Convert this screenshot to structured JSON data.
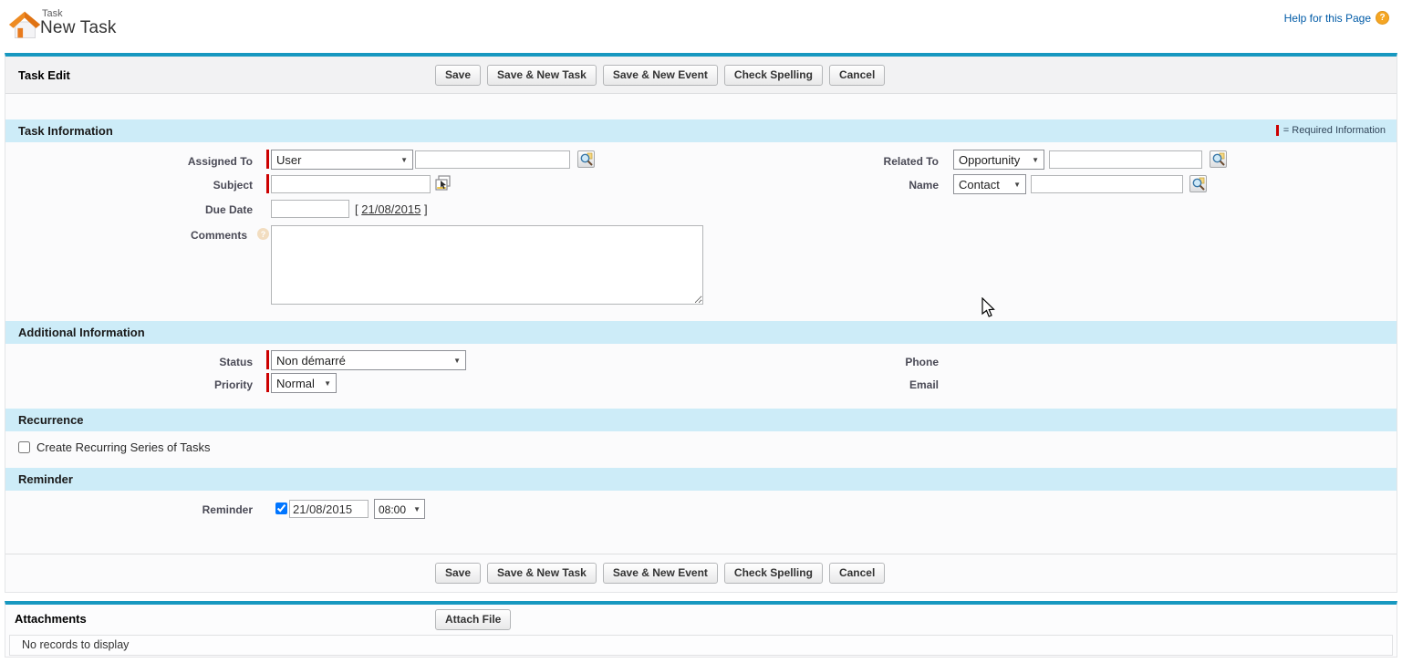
{
  "page": {
    "entity_label": "Task",
    "title": "New Task",
    "help_link": "Help for this Page"
  },
  "icons": {
    "dropdown_arrow": "▼",
    "help_question": "?",
    "comments_help": "?",
    "app_icon": "task-home-icon",
    "lookup": "magnifier-icon",
    "subject_combo": "combobox-picker-icon"
  },
  "task_edit": {
    "title": "Task Edit",
    "buttons": [
      "Save",
      "Save & New Task",
      "Save & New Event",
      "Check Spelling",
      "Cancel"
    ]
  },
  "sections": {
    "task_information": {
      "title": "Task Information",
      "required_legend": "= Required Information",
      "fields": {
        "assigned_to": {
          "label": "Assigned To",
          "required": true,
          "type_value": "User",
          "text_value": ""
        },
        "related_to": {
          "label": "Related To",
          "type_value": "Opportunity",
          "text_value": ""
        },
        "subject": {
          "label": "Subject",
          "required": true,
          "value": ""
        },
        "name": {
          "label": "Name",
          "type_value": "Contact",
          "text_value": ""
        },
        "due_date": {
          "label": "Due Date",
          "value": "",
          "bracket_left": "[",
          "today_link": "21/08/2015",
          "bracket_right": "]"
        },
        "comments": {
          "label": "Comments",
          "value": ""
        }
      }
    },
    "additional_information": {
      "title": "Additional Information",
      "fields": {
        "status": {
          "label": "Status",
          "required": true,
          "value": "Non démarré"
        },
        "priority": {
          "label": "Priority",
          "required": true,
          "value": "Normal"
        },
        "phone": {
          "label": "Phone",
          "value": ""
        },
        "email": {
          "label": "Email",
          "value": ""
        }
      }
    },
    "recurrence": {
      "title": "Recurrence",
      "checkbox_label": "Create Recurring Series of Tasks",
      "checked": false
    },
    "reminder": {
      "title": "Reminder",
      "label": "Reminder",
      "checked": true,
      "date_value": "21/08/2015",
      "time_value": "08:00"
    }
  },
  "bottom_buttons": [
    "Save",
    "Save & New Task",
    "Save & New Event",
    "Check Spelling",
    "Cancel"
  ],
  "attachments": {
    "title": "Attachments",
    "attach_button": "Attach File",
    "empty_text": "No records to display"
  },
  "colors": {
    "teal_bar": "#1798c0",
    "section_header_bg": "#cdecf8",
    "required_red": "#cc0000",
    "link_blue": "#015ba7",
    "help_icon_orange": "#f5a623",
    "label_gray": "#4a4a56"
  }
}
